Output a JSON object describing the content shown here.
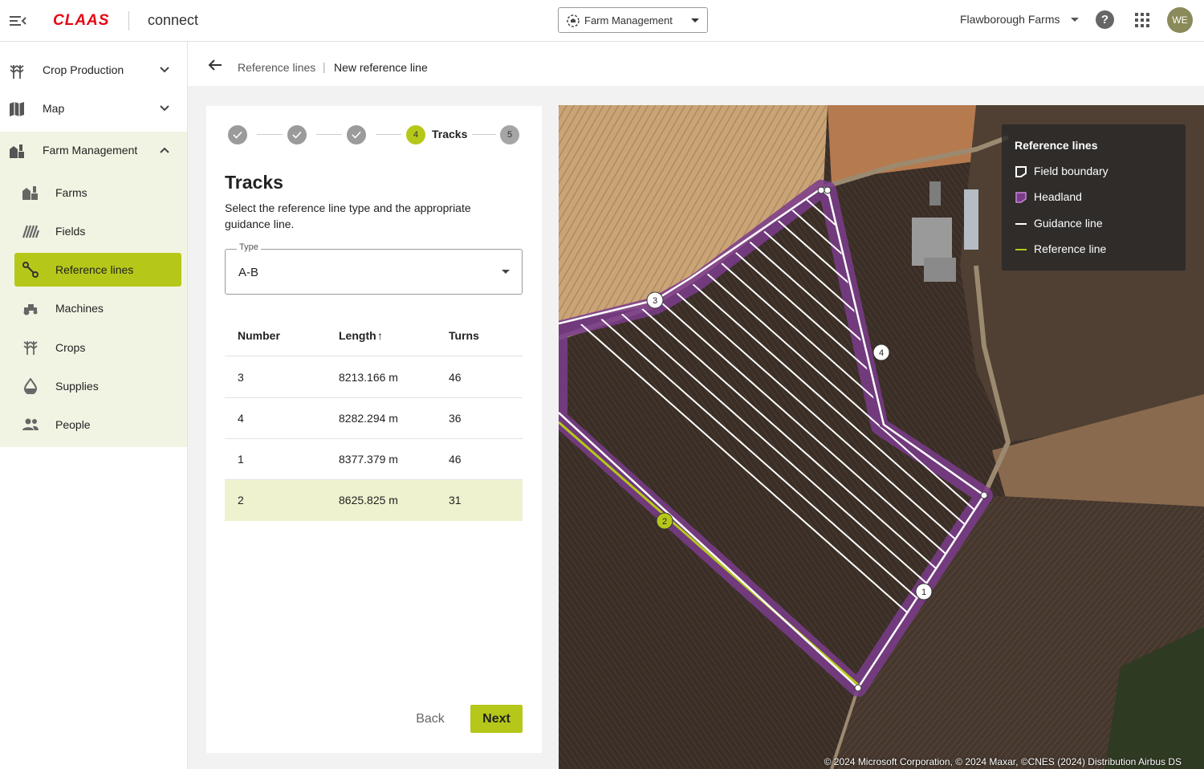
{
  "header": {
    "brand": "CLAAS",
    "app_name": "connect",
    "module_select": "Farm Management",
    "farm_select": "Flawborough Farms",
    "help_label": "?",
    "user_initials": "WE"
  },
  "sidebar": {
    "top_items": [
      {
        "label": "Crop Production",
        "icon": "wheat-icon",
        "expanded": false
      },
      {
        "label": "Map",
        "icon": "map-icon",
        "expanded": false
      },
      {
        "label": "Farm Management",
        "icon": "farm-icon",
        "expanded": true
      }
    ],
    "sub_items": [
      {
        "label": "Farms",
        "icon": "farm-buildings-icon"
      },
      {
        "label": "Fields",
        "icon": "fields-icon"
      },
      {
        "label": "Reference lines",
        "icon": "reference-line-icon",
        "active": true
      },
      {
        "label": "Machines",
        "icon": "tractor-icon"
      },
      {
        "label": "Crops",
        "icon": "crop-icon"
      },
      {
        "label": "Supplies",
        "icon": "droplet-icon"
      },
      {
        "label": "People",
        "icon": "people-icon"
      }
    ]
  },
  "breadcrumb": {
    "parent": "Reference lines",
    "separator": "|",
    "current": "New reference line"
  },
  "stepper": {
    "current_step": 4,
    "current_label": "Tracks",
    "pending_step": 5
  },
  "panel": {
    "title": "Tracks",
    "description": "Select the reference line type and the appropriate guidance line.",
    "type_label": "Type",
    "type_value": "A-B"
  },
  "table": {
    "columns": [
      "Number",
      "Length",
      "Turns"
    ],
    "sort_indicator": "↑",
    "rows": [
      {
        "number": "3",
        "length": "8213.166 m",
        "turns": "46"
      },
      {
        "number": "4",
        "length": "8282.294 m",
        "turns": "36"
      },
      {
        "number": "1",
        "length": "8377.379 m",
        "turns": "46"
      },
      {
        "number": "2",
        "length": "8625.825 m",
        "turns": "31",
        "selected": true
      }
    ]
  },
  "buttons": {
    "back": "Back",
    "next": "Next"
  },
  "map": {
    "legend_title": "Reference lines",
    "legend_items": [
      "Field boundary",
      "Headland",
      "Guidance line",
      "Reference line"
    ],
    "markers": [
      "1",
      "2",
      "3",
      "4"
    ],
    "copyright": "© 2024 Microsoft Corporation, © 2024 Maxar, ©CNES (2024) Distribution Airbus DS",
    "colors": {
      "boundary": "#ffffff",
      "headland": "#7b3c8c",
      "guidance": "#ffffff",
      "reference": "#b5c819"
    }
  },
  "colors": {
    "accent": "#b5c819",
    "brand": "#e30613"
  }
}
